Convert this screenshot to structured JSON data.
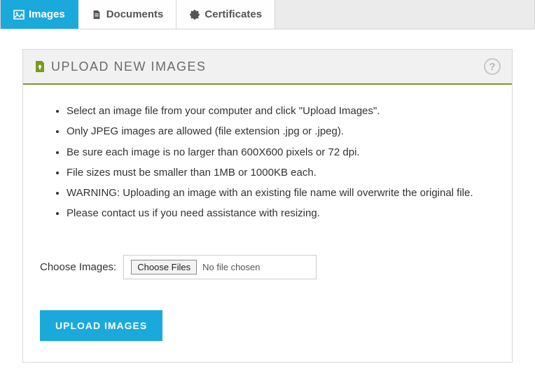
{
  "tabs": [
    {
      "label": "Images",
      "icon": "image-icon",
      "active": true
    },
    {
      "label": "Documents",
      "icon": "document-icon",
      "active": false
    },
    {
      "label": "Certificates",
      "icon": "certificate-icon",
      "active": false
    }
  ],
  "panel": {
    "title": "UPLOAD NEW IMAGES",
    "help_symbol": "?",
    "instructions": [
      "Select an image file from your computer and click \"Upload Images\".",
      "Only JPEG images are allowed (file extension .jpg or .jpeg).",
      "Be sure each image is no larger than 600X600 pixels or 72 dpi.",
      "File sizes must be smaller than 1MB or 1000KB each.",
      "WARNING: Uploading an image with an existing file name will overwrite the original file.",
      "Please contact us if you need assistance with resizing."
    ],
    "file_label": "Choose Images:",
    "choose_button": "Choose Files",
    "file_status": "No file chosen",
    "upload_button": "UPLOAD IMAGES"
  },
  "colors": {
    "accent": "#1aa9db",
    "header_rule": "#7a9a1e"
  }
}
